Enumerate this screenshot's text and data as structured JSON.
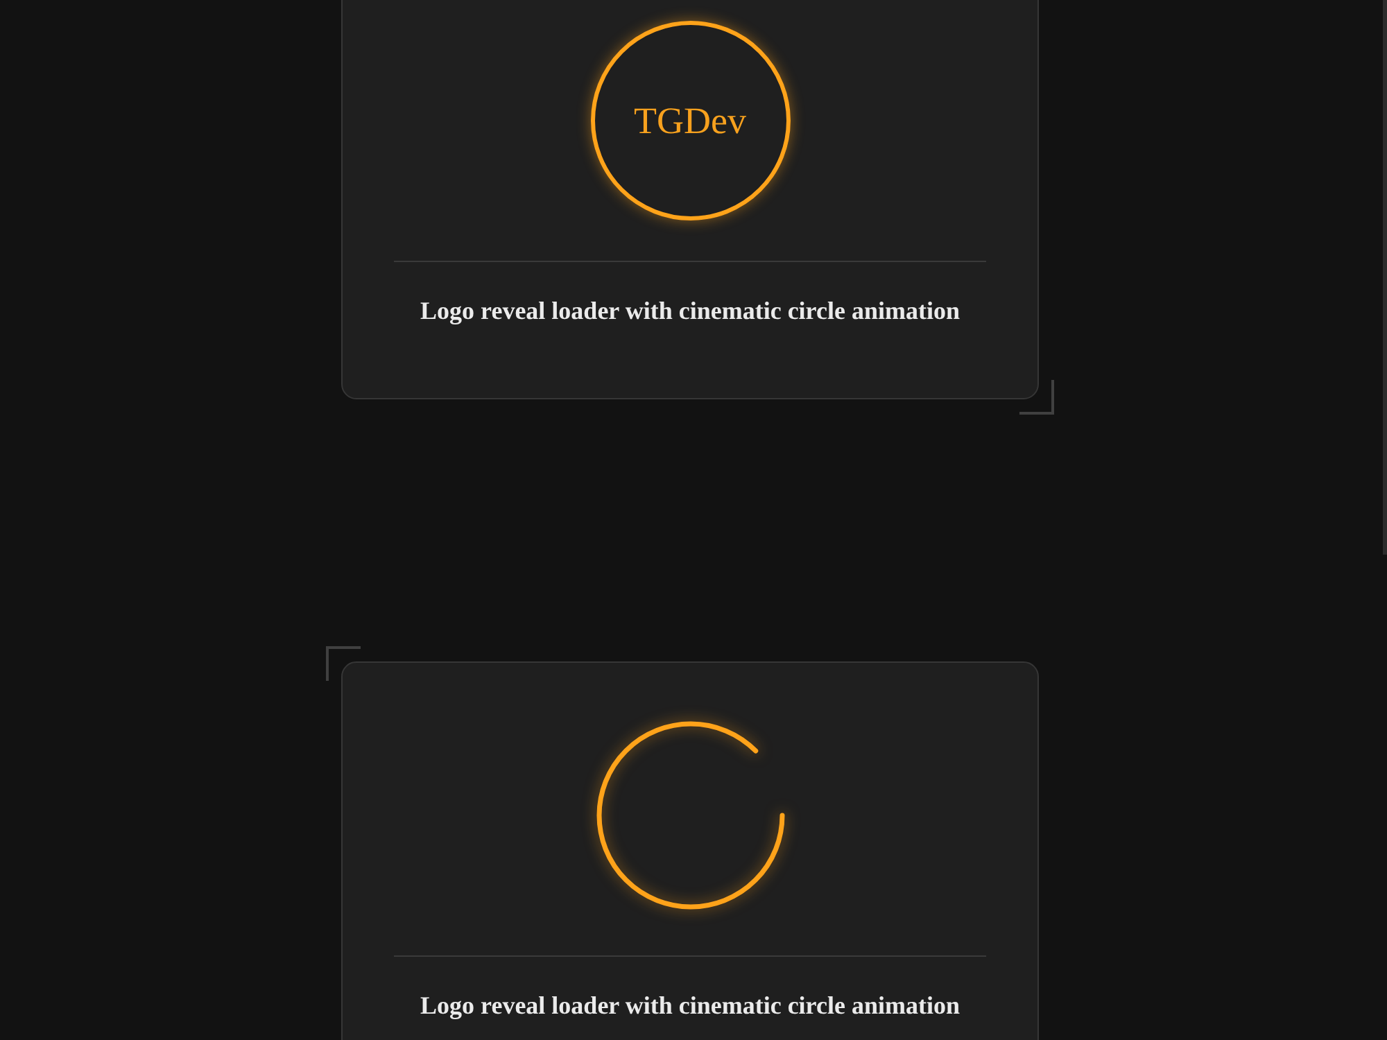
{
  "cards": [
    {
      "loader": {
        "kind": "logo_ring",
        "logo": "TGDev"
      },
      "caption": "Logo reveal loader with cinematic circle animation",
      "corner_brackets": {
        "top_left": false,
        "bottom_right": true
      }
    },
    {
      "loader": {
        "kind": "arc_spinner"
      },
      "caption": "Logo reveal loader with cinematic circle animation",
      "corner_brackets": {
        "top_left": true,
        "bottom_right": false
      }
    }
  ]
}
